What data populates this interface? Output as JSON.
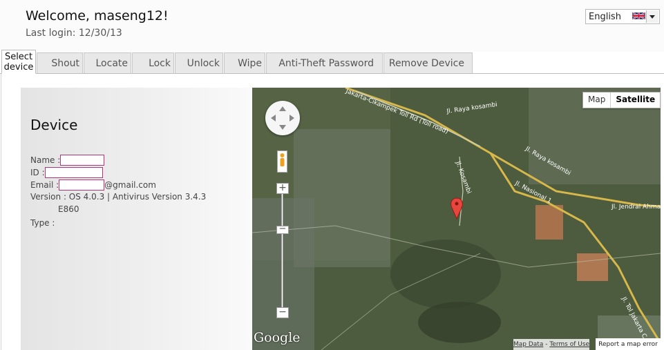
{
  "header": {
    "welcome": "Welcome, maseng12!",
    "last_login": "Last login: 12/30/13"
  },
  "language": {
    "selected": "English",
    "flag_icon": "uk-flag-icon"
  },
  "tabs": [
    {
      "label": "Select device",
      "selected": true
    },
    {
      "label": "Shout"
    },
    {
      "label": "Locate"
    },
    {
      "label": "Lock"
    },
    {
      "label": "Unlock"
    },
    {
      "label": "Wipe"
    },
    {
      "label": "Anti-Theft Password"
    },
    {
      "label": "Remove Device"
    }
  ],
  "device": {
    "title": "Device",
    "name_label": "Name :",
    "id_label": "ID :",
    "email_label": "Email :",
    "email_suffix": "@gmail.com",
    "version_label": "Version : OS 4.0.3  |  Antivirus Version 3.4.3",
    "model": "E860",
    "type_label": "Type :"
  },
  "map": {
    "type_map": "Map",
    "type_satellite": "Satellite",
    "zoom_in": "+",
    "zoom_out": "−",
    "logo": "Google",
    "map_data": "Map Data",
    "terms": "Terms of Use",
    "report": "Report a map error",
    "roads": {
      "toll": "Jakarta-Cikampek Toll Rd (Toll road)",
      "kosambi": "Jl. Raya kosambi",
      "kosambi2": "Jl. Raya kosambi",
      "kosambi3": "Jl. Kosambi",
      "nasional": "Jl. Nasional 1",
      "jendral": "Jl. Jendral Ahma",
      "toljakarta": "Jl. Tol Jakarta C"
    }
  },
  "colors": {
    "accent_redact": "#b5317c",
    "map_bg": "#4a5a3c",
    "road_yellow": "#d8b84a"
  }
}
